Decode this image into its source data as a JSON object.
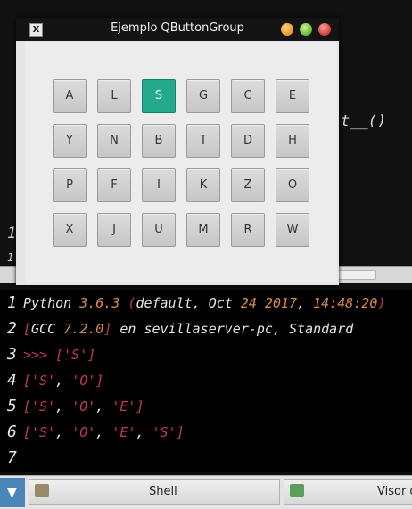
{
  "window": {
    "title": "Ejemplo QButtonGroup",
    "app_icon": "x-app-icon",
    "controls": [
      "minimize-icon",
      "maximize-icon",
      "close-icon"
    ]
  },
  "button_grid": {
    "rows": [
      [
        "A",
        "L",
        "S",
        "G",
        "C",
        "E"
      ],
      [
        "Y",
        "N",
        "B",
        "T",
        "D",
        "H"
      ],
      [
        "P",
        "F",
        "I",
        "K",
        "Z",
        "O"
      ],
      [
        "X",
        "J",
        "U",
        "M",
        "R",
        "W"
      ]
    ],
    "checked": "S",
    "checked_color": "#22a98e"
  },
  "background_editor": {
    "right_code": "t__()",
    "gutter_numbers": [
      "1",
      "1"
    ]
  },
  "shell": {
    "lines": [
      {
        "no": "1",
        "text": "Python 3.6.3 (default, Oct 24 2017, 14:48:20)"
      },
      {
        "no": "2",
        "text": "[GCC 7.2.0] en sevillaserver-pc, Standard"
      },
      {
        "no": "3",
        "text": ">>> ['S']"
      },
      {
        "no": "4",
        "text": "['S', 'O']"
      },
      {
        "no": "5",
        "text": "['S', 'O', 'E']"
      },
      {
        "no": "6",
        "text": "['S', 'O', 'E', 'S']"
      },
      {
        "no": "7",
        "text": ""
      }
    ]
  },
  "taskbar": {
    "tasks": [
      {
        "label": "Shell",
        "icon": "shell-app-icon"
      },
      {
        "label": "Visor d",
        "icon": "visor-app-icon"
      }
    ]
  }
}
